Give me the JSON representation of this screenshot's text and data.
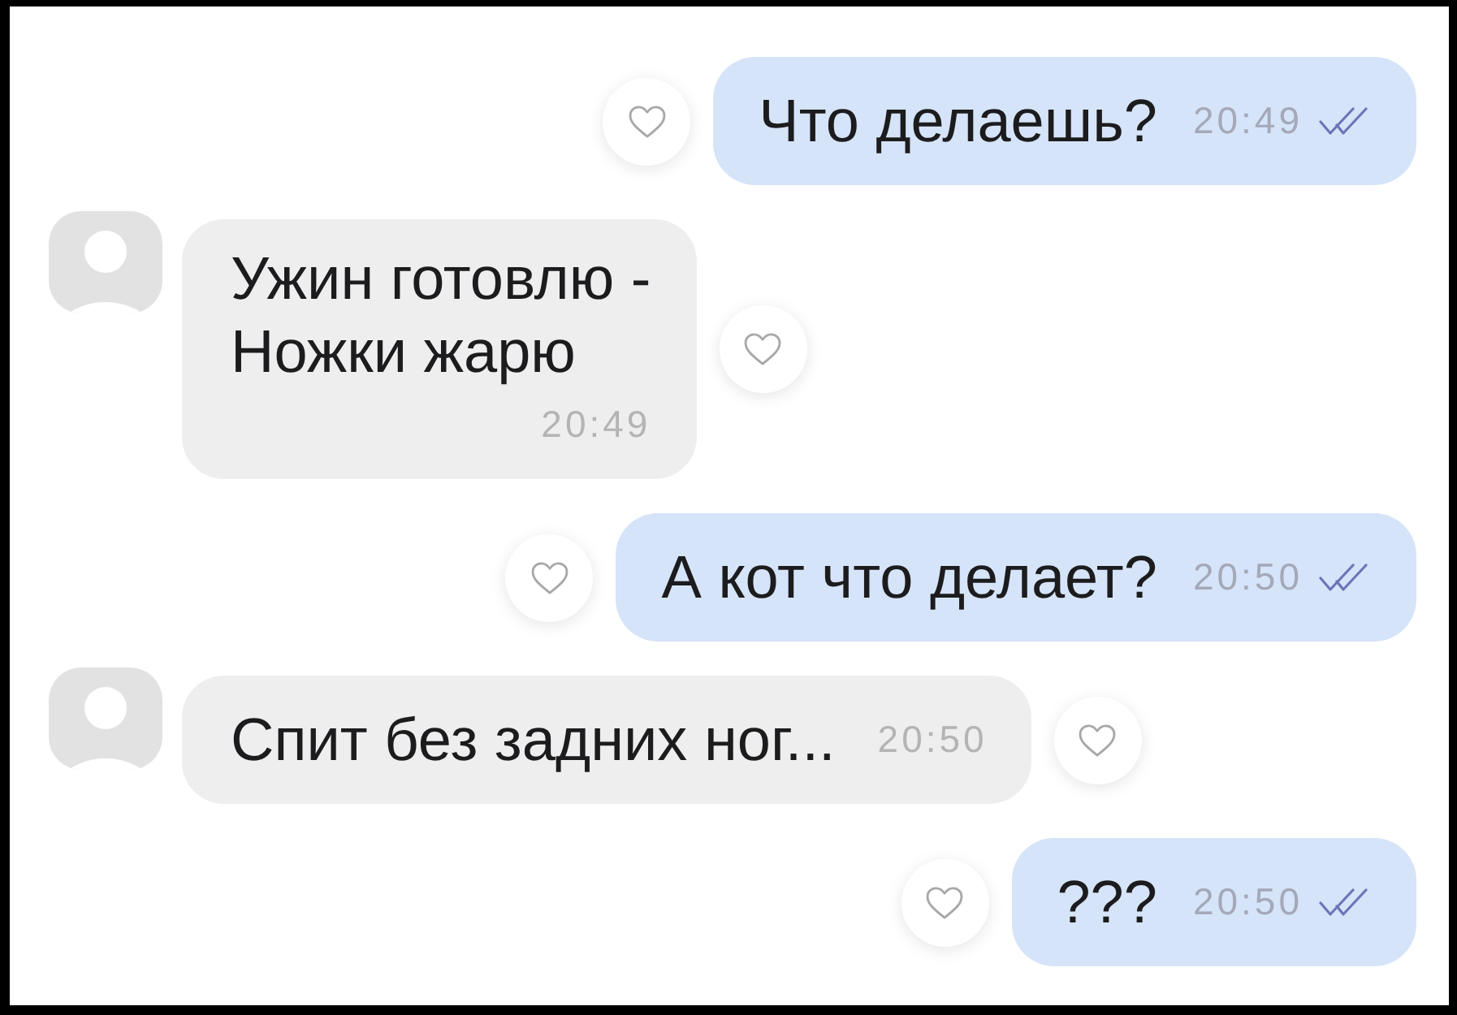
{
  "messages": [
    {
      "kind": "outgoing",
      "lines": [
        "Что делаешь?"
      ],
      "time": "20:49",
      "read": true
    },
    {
      "kind": "incoming",
      "lines": [
        "Ужин готовлю -",
        "Ножки жарю"
      ],
      "time": "20:49"
    },
    {
      "kind": "outgoing",
      "lines": [
        "А кот что делает?"
      ],
      "time": "20:50",
      "read": true
    },
    {
      "kind": "incoming",
      "lines": [
        "Спит без задних ног..."
      ],
      "time": "20:50"
    },
    {
      "kind": "outgoing",
      "lines": [
        "???"
      ],
      "time": "20:50",
      "read": true
    }
  ]
}
